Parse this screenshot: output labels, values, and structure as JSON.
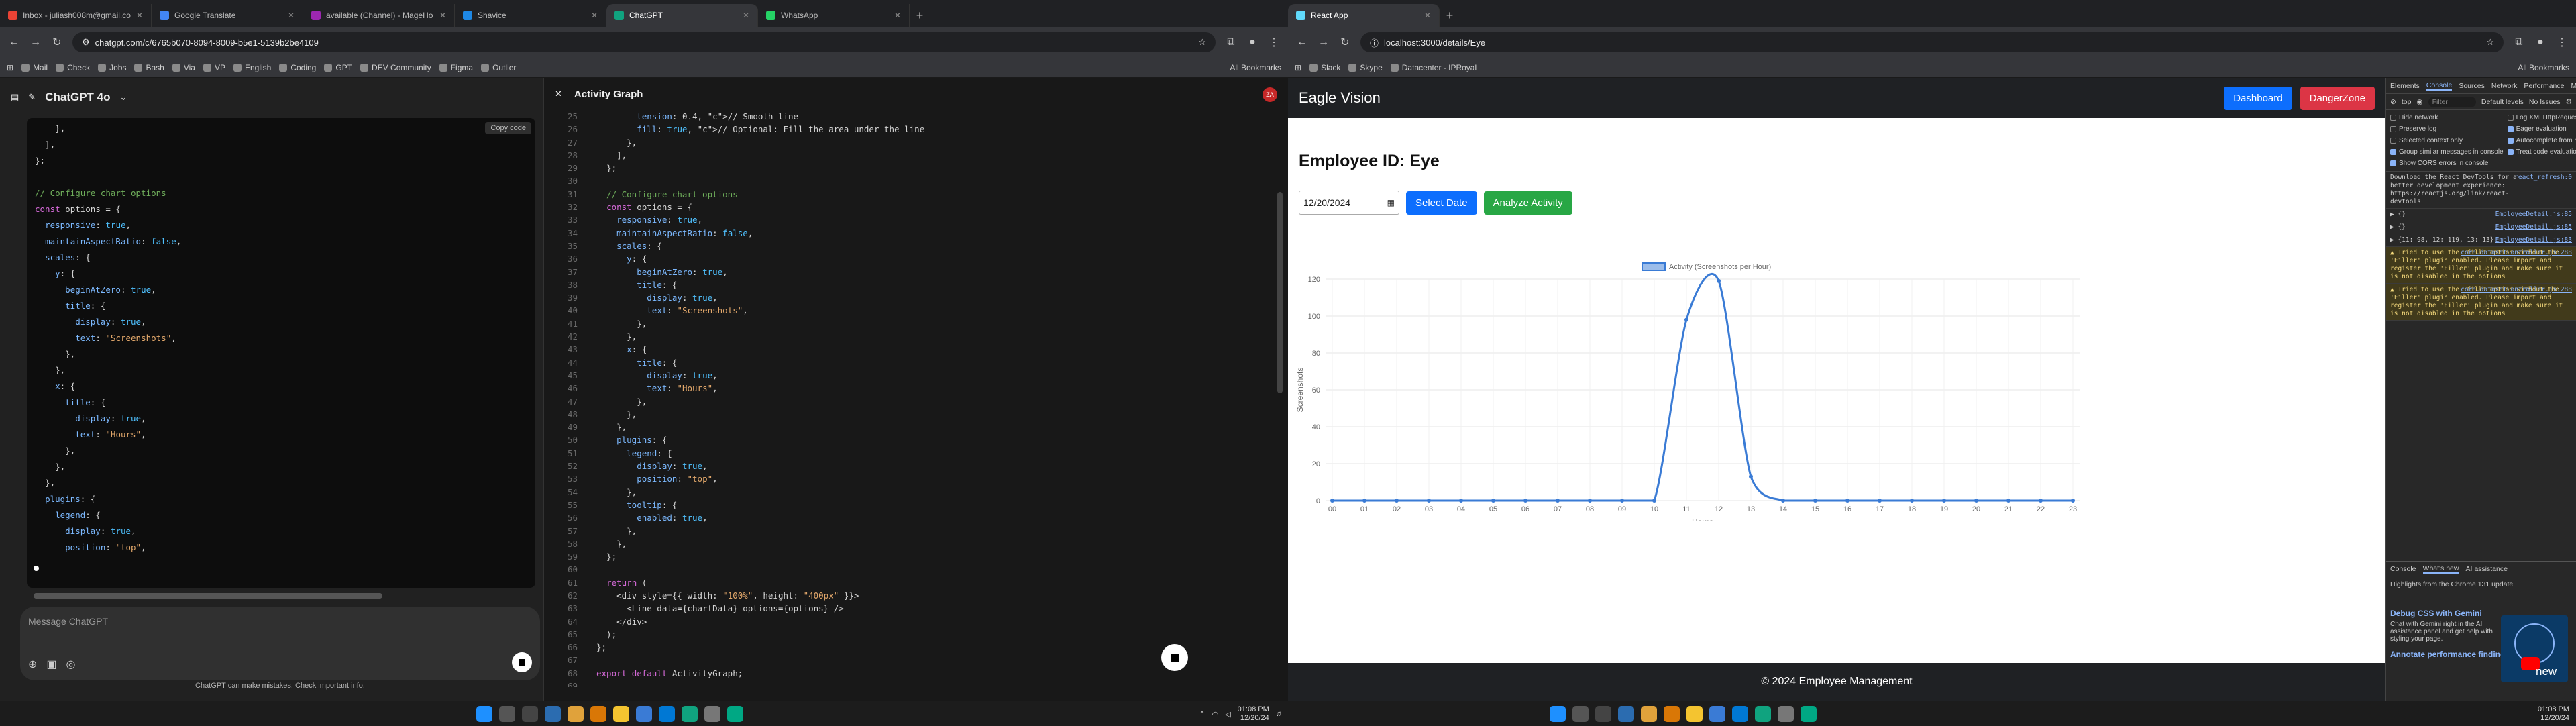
{
  "left_browser": {
    "tabs": [
      {
        "label": "Inbox - juliash008m@gmail.co",
        "color": "#ea4335"
      },
      {
        "label": "Google Translate",
        "color": "#4285f4"
      },
      {
        "label": "available (Channel) - MageHo",
        "color": "#9c27b0"
      },
      {
        "label": "Shavice",
        "color": "#1e88e5"
      },
      {
        "label": "ChatGPT",
        "color": "#10a37f"
      },
      {
        "label": "WhatsApp",
        "color": "#25d366"
      }
    ],
    "url": "chatgpt.com/c/6765b070-8094-8009-b5e1-5139b2be4109",
    "bookmarks": [
      "Mail",
      "Check",
      "Jobs",
      "Bash",
      "Via",
      "VP",
      "English",
      "Coding",
      "GPT",
      "DEV Community",
      "Figma",
      "Outlier"
    ],
    "all_bookmarks": "All Bookmarks"
  },
  "chatgpt": {
    "model": "ChatGPT 4o",
    "copy_label": "Copy code",
    "message_placeholder": "Message ChatGPT",
    "disclaimer": "ChatGPT can make mistakes. Check important info.",
    "code_lines": [
      "    },",
      "  ],",
      "};",
      "",
      "// Configure chart options",
      "const options = {",
      "  responsive: true,",
      "  maintainAspectRatio: false,",
      "  scales: {",
      "    y: {",
      "      beginAtZero: true,",
      "      title: {",
      "        display: true,",
      "        text: \"Screenshots\",",
      "      },",
      "    },",
      "    x: {",
      "      title: {",
      "        display: true,",
      "        text: \"Hours\",",
      "      },",
      "    },",
      "  },",
      "  plugins: {",
      "    legend: {",
      "      display: true,",
      "      position: \"top\","
    ]
  },
  "canvas": {
    "title": "Activity Graph",
    "avatar": "ZA",
    "line_numbers": [
      "25",
      "26",
      "27",
      "28",
      "29",
      "30",
      "31",
      "32",
      "33",
      "34",
      "35",
      "36",
      "37",
      "38",
      "39",
      "40",
      "41",
      "42",
      "43",
      "44",
      "45",
      "46",
      "47",
      "48",
      "49",
      "50",
      "51",
      "52",
      "53",
      "54",
      "55",
      "56",
      "57",
      "58",
      "59",
      "60",
      "61",
      "62",
      "63",
      "64",
      "65",
      "66",
      "67",
      "68",
      "69"
    ],
    "code_lines": [
      "        tension: 0.4, // Smooth line",
      "        fill: true, // Optional: Fill the area under the line",
      "      },",
      "    ],",
      "  };",
      "",
      "  // Configure chart options",
      "  const options = {",
      "    responsive: true,",
      "    maintainAspectRatio: false,",
      "    scales: {",
      "      y: {",
      "        beginAtZero: true,",
      "        title: {",
      "          display: true,",
      "          text: \"Screenshots\",",
      "        },",
      "      },",
      "      x: {",
      "        title: {",
      "          display: true,",
      "          text: \"Hours\",",
      "        },",
      "      },",
      "    },",
      "    plugins: {",
      "      legend: {",
      "        display: true,",
      "        position: \"top\",",
      "      },",
      "      tooltip: {",
      "        enabled: true,",
      "      },",
      "    },",
      "  };",
      "",
      "  return (",
      "    <div style={{ width: \"100%\", height: \"400px\" }}>",
      "      <Line data={chartData} options={options} />",
      "    </div>",
      "  );",
      "};",
      "",
      "export default ActivityGraph;",
      ""
    ]
  },
  "right_browser": {
    "tabs": [
      {
        "label": "React App",
        "color": "#61dafb"
      }
    ],
    "url": "localhost:3000/details/Eye",
    "bookmarks": [
      "Slack",
      "Skype",
      "Datacenter - IPRoyal"
    ],
    "all_bookmarks": "All Bookmarks"
  },
  "app": {
    "brand": "Eagle Vision",
    "dashboard_label": "Dashboard",
    "dangerzone_label": "DangerZone",
    "employee_heading": "Employee ID: Eye",
    "date_value": "12/20/2024",
    "select_date_label": "Select Date",
    "analyze_label": "Analyze Activity",
    "footer": "© 2024 Employee Management",
    "colors": {
      "primary": "#0d6efd",
      "danger": "#dc3545",
      "success": "#28a745",
      "line": "#3a7bd5"
    }
  },
  "chart_data": {
    "type": "line",
    "title": "",
    "legend": [
      "Activity (Screenshots per Hour)"
    ],
    "legend_position": "top",
    "xlabel": "Hours",
    "ylabel": "Screenshots",
    "ylim": [
      0,
      120
    ],
    "yticks": [
      0,
      20,
      40,
      60,
      80,
      100,
      120
    ],
    "categories": [
      "00",
      "01",
      "02",
      "03",
      "04",
      "05",
      "06",
      "07",
      "08",
      "09",
      "10",
      "11",
      "12",
      "13",
      "14",
      "15",
      "16",
      "17",
      "18",
      "19",
      "20",
      "21",
      "22",
      "23"
    ],
    "series": [
      {
        "name": "Activity (Screenshots per Hour)",
        "values": [
          0,
          0,
          0,
          0,
          0,
          0,
          0,
          0,
          0,
          0,
          0,
          98,
          119,
          13,
          0,
          0,
          0,
          0,
          0,
          0,
          0,
          0,
          0,
          0
        ]
      }
    ],
    "grid": true
  },
  "devtools": {
    "tabs": [
      "Elements",
      "Console",
      "Sources",
      "Network",
      "Performance",
      "Memory"
    ],
    "context": "top",
    "filter_placeholder": "Filter",
    "levels": "Default levels",
    "issues": "No Issues",
    "options": [
      "Hide network",
      "Log XMLHttpRequests",
      "Preserve log",
      "Eager evaluation",
      "Selected context only",
      "Autocomplete from history",
      "Group similar messages in console",
      "Treat code evaluation as user action",
      "Show CORS errors in console"
    ],
    "messages": [
      {
        "text": "Download the React DevTools for a better development experience: https://reactjs.org/link/react-devtools",
        "src": "react_refresh:0",
        "kind": "info"
      },
      {
        "text": "▶ {}",
        "src": "EmployeeDetail.js:85",
        "kind": "info"
      },
      {
        "text": "▶ {}",
        "src": "EmployeeDetail.js:85",
        "kind": "info"
      },
      {
        "text": "▶ {11: 98, 12: 119, 13: 13}",
        "src": "EmployeeDetail.js:83",
        "kind": "info"
      },
      {
        "text": "▲ Tried to use the 'fill' option without the 'Filler' plugin enabled. Please import and register the 'Filler' plugin and make sure it is not disabled in the options",
        "src": "core.datasetController.js:288",
        "kind": "warn"
      },
      {
        "text": "▲ Tried to use the 'fill' option without the 'Filler' plugin enabled. Please import and register the 'Filler' plugin and make sure it is not disabled in the options",
        "src": "core.datasetController.js:288",
        "kind": "warn"
      }
    ],
    "drawer_tabs": [
      "Console",
      "What's new",
      "AI assistance"
    ],
    "whats_new_head": "Highlights from the Chrome 131 update",
    "whats_new_link1": "Debug CSS with Gemini",
    "whats_new_desc": "Chat with Gemini right in the AI assistance panel and get help with styling your page.",
    "whats_new_link2": "Annotate performance findings",
    "new_label": "new"
  },
  "taskbar": {
    "time": "01:08 PM",
    "date": "12/20/24"
  }
}
